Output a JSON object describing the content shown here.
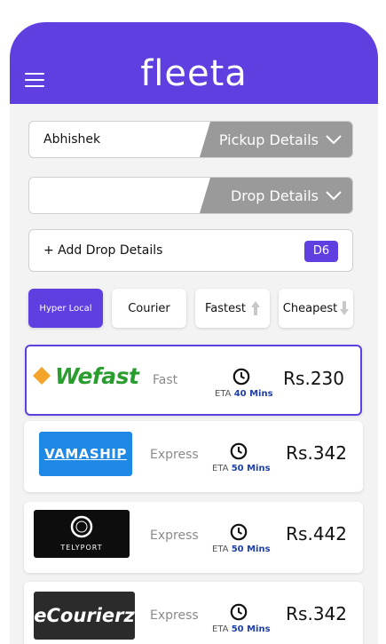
{
  "app": {
    "brand": "fleeta"
  },
  "pickup": {
    "value": "Abhishek",
    "tag": "Pickup  Details"
  },
  "drop": {
    "value": "",
    "tag": "Drop  Details"
  },
  "add_drop": {
    "label": "+ Add Drop Details",
    "badge": "D6"
  },
  "filters": [
    {
      "label": "Hyper Local",
      "active": true
    },
    {
      "label": "Courier",
      "active": false
    },
    {
      "label": "Fastest",
      "active": false
    },
    {
      "label": "Cheapest",
      "active": false
    }
  ],
  "couriers": [
    {
      "logo": "Wefast",
      "speed": "Fast",
      "eta_prefix": "ETA",
      "eta": "40 Mins",
      "price": "Rs.230",
      "selected": true
    },
    {
      "logo": "VAMASHIP",
      "speed": "Express",
      "eta_prefix": "ETA",
      "eta": "50 Mins",
      "price": "Rs.342",
      "selected": false
    },
    {
      "logo": "TELYPORT",
      "speed": "Express",
      "eta_prefix": "ETA",
      "eta": "50 Mins",
      "price": "Rs.442",
      "selected": false
    },
    {
      "logo": "eCourierz",
      "speed": "Express",
      "eta_prefix": "ETA",
      "eta": "50 Mins",
      "price": "Rs.342",
      "selected": false
    }
  ],
  "colors": {
    "accent": "#5f3fe0",
    "tag_gray": "#9a9a9a",
    "eta_blue": "#1e3fa8"
  }
}
